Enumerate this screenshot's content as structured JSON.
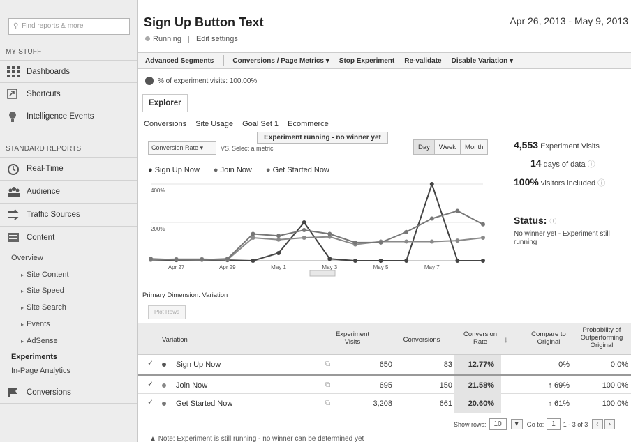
{
  "sidebar": {
    "search_placeholder": "Find reports & more",
    "my_stuff_title": "MY STUFF",
    "my_stuff": [
      {
        "label": "Dashboards",
        "icon": "dashboard-grid-icon"
      },
      {
        "label": "Shortcuts",
        "icon": "shortcuts-icon"
      },
      {
        "label": "Intelligence Events",
        "icon": "lightbulb-icon"
      }
    ],
    "standard_title": "STANDARD REPORTS",
    "standard": [
      {
        "label": "Real-Time",
        "icon": "realtime-icon"
      },
      {
        "label": "Audience",
        "icon": "audience-icon"
      },
      {
        "label": "Traffic Sources",
        "icon": "traffic-sources-icon"
      },
      {
        "label": "Content",
        "icon": "content-icon"
      }
    ],
    "content_sub": [
      "Overview",
      "Site Content",
      "Site Speed",
      "Site Search",
      "Events",
      "AdSense",
      "Experiments",
      "In-Page Analytics"
    ],
    "conversions": "Conversions"
  },
  "header": {
    "title": "Sign Up Button Text",
    "status": "Running",
    "edit": "Edit settings",
    "date_range": "Apr 26, 2013 - May 9, 2013"
  },
  "toolbar": [
    "Advanced Segments",
    "Conversions / Page Metrics ▾",
    "Stop Experiment",
    "Re-validate",
    "Disable Variation ▾"
  ],
  "pct_visits": "% of experiment visits: 100.00%",
  "tab": "Explorer",
  "subnav": [
    "Conversions",
    "Site Usage",
    "Goal Set 1",
    "Ecommerce"
  ],
  "banner": "Experiment running - no winner yet",
  "metric_select": "Conversion Rate ▾",
  "vs": "VS.",
  "select_metric": "Select a metric",
  "range_buttons": [
    "Day",
    "Week",
    "Month"
  ],
  "stats": {
    "visits": "4,553",
    "visits_label": "Experiment Visits",
    "days": "14",
    "days_label": "days of data",
    "included": "100%",
    "included_label": "visitors included",
    "status_label": "Status:",
    "status_text": "No winner yet - Experiment still running"
  },
  "chart_data": {
    "type": "line",
    "x": [
      "Apr 26",
      "Apr 27",
      "Apr 28",
      "Apr 29",
      "Apr 30",
      "May 1",
      "May 2",
      "May 3",
      "May 4",
      "May 5",
      "May 6",
      "May 7",
      "May 8",
      "May 9"
    ],
    "x_tick_labels": [
      "Apr 27",
      "Apr 29",
      "May 1",
      "May 3",
      "May 5",
      "May 7"
    ],
    "y_tick_labels": [
      "400%",
      "200%"
    ],
    "ylim": [
      0,
      400
    ],
    "series": [
      {
        "name": "Sign Up Now",
        "color": "#444444",
        "values": [
          5,
          3,
          5,
          3,
          0,
          40,
          200,
          10,
          0,
          0,
          0,
          400,
          0,
          0
        ]
      },
      {
        "name": "Join Now",
        "color": "#8a8a8a",
        "values": [
          5,
          8,
          8,
          5,
          120,
          110,
          120,
          125,
          85,
          100,
          100,
          100,
          105,
          120
        ]
      },
      {
        "name": "Get Started Now",
        "color": "#777777",
        "values": [
          10,
          5,
          5,
          10,
          140,
          130,
          160,
          140,
          95,
          95,
          150,
          220,
          260,
          190
        ]
      }
    ]
  },
  "primary_dimension_label": "Primary Dimension:",
  "primary_dimension_value": "Variation",
  "plot_rows": "Plot Rows",
  "table": {
    "headers": [
      "Variation",
      "Experiment Visits",
      "Conversions",
      "Conversion Rate",
      "Compare to Original",
      "Probability of Outperforming Original"
    ],
    "rows": [
      {
        "name": "Sign Up Now",
        "visits": "650",
        "conversions": "83",
        "rate": "12.77%",
        "compare": "0%",
        "prob": "0.0%"
      },
      {
        "name": "Join Now",
        "visits": "695",
        "conversions": "150",
        "rate": "21.58%",
        "compare": "↑ 69%",
        "prob": "100.0%"
      },
      {
        "name": "Get Started Now",
        "visits": "3,208",
        "conversions": "661",
        "rate": "20.60%",
        "compare": "↑ 61%",
        "prob": "100.0%"
      }
    ]
  },
  "pagination": {
    "show_rows_label": "Show rows:",
    "show_rows_value": "10",
    "goto_label": "Go to:",
    "goto_value": "1",
    "range": "1 - 3 of 3"
  },
  "note": "Note: Experiment is still running - no winner can be determined yet"
}
